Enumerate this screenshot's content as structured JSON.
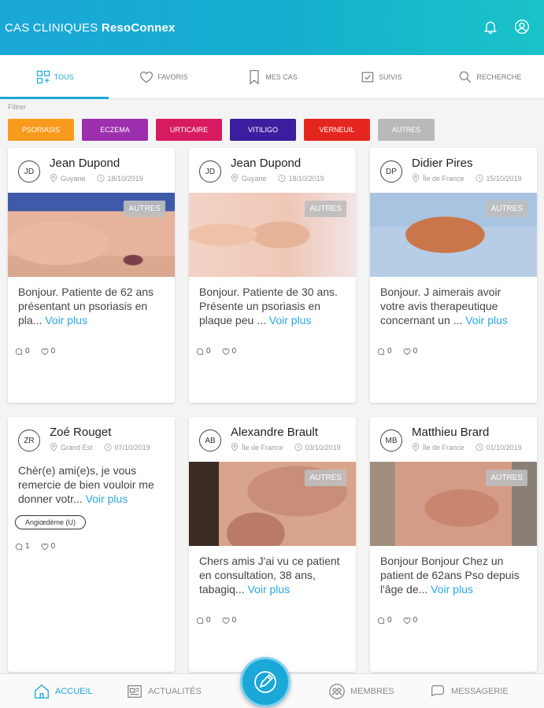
{
  "header": {
    "title_prefix": "CAS CLINIQUES",
    "title_brand": "ResoConnex"
  },
  "tabs": [
    {
      "label": "TOUS",
      "icon": "grid-icon",
      "active": true
    },
    {
      "label": "FAVORIS",
      "icon": "heart-icon"
    },
    {
      "label": "MES CAS",
      "icon": "bookmark-icon"
    },
    {
      "label": "SUIVIS",
      "icon": "follow-icon"
    },
    {
      "label": "RECHERCHE",
      "icon": "search-icon"
    }
  ],
  "filter_label": "Filtrer",
  "filters": [
    "PSORIASIS",
    "ECZEMA",
    "URTICAIRE",
    "VITILIGO",
    "VERNEUIL",
    "AUTRES"
  ],
  "colors": {
    "primary": "#1ba7d8",
    "link": "#2ba7e0"
  },
  "cards": [
    {
      "initials": "JD",
      "name": "Jean Dupond",
      "location": "Guyane",
      "date": "18/10/2019",
      "badge": "AUTRES",
      "text": "Bonjour. Patiente de 62 ans présentant un psoriasis en pla...",
      "more": "Voir plus",
      "comments": "0",
      "likes": "0"
    },
    {
      "initials": "JD",
      "name": "Jean Dupond",
      "location": "Guyane",
      "date": "18/10/2019",
      "badge": "AUTRES",
      "text": "Bonjour. Patiente de 30 ans. Présente un psoriasis en plaque peu ...",
      "more": "Voir plus",
      "comments": "0",
      "likes": "0"
    },
    {
      "initials": "DP",
      "name": "Didier Pires",
      "location": "Île de France",
      "date": "15/10/2019",
      "badge": "AUTRES",
      "text": "Bonjour. J aimerais avoir votre avis therapeutique concernant un ...",
      "more": "Voir plus",
      "comments": "0",
      "likes": "0"
    },
    {
      "initials": "ZR",
      "name": "Zoé Rouget",
      "location": "Grand Est",
      "date": "07/10/2019",
      "text": "Chèr(e) ami(e)s, je vous remercie de bien vouloir me donner votr...",
      "more": "Voir plus",
      "tag": "Angiœdème (U)",
      "comments": "1",
      "likes": "0"
    },
    {
      "initials": "AB",
      "name": "Alexandre Brault",
      "location": "Île de France",
      "date": "03/10/2019",
      "badge": "AUTRES",
      "text": "Chers amis J'ai vu ce patient en consultation, 38 ans, tabagiq...",
      "more": "Voir plus",
      "comments": "0",
      "likes": "0"
    },
    {
      "initials": "MB",
      "name": "Matthieu Brard",
      "location": "Île de France",
      "date": "01/10/2019",
      "badge": "AUTRES",
      "text": "Bonjour Bonjour Chez un patient de 62ans Pso depuis l'âge de...",
      "more": "Voir plus",
      "comments": "0",
      "likes": "0"
    }
  ],
  "bottom_nav": [
    {
      "label": "ACCUEIL",
      "icon": "home-icon",
      "active": true
    },
    {
      "label": "ACTUALITÉS",
      "icon": "news-icon"
    },
    {
      "label": "MEMBRES",
      "icon": "members-icon"
    },
    {
      "label": "MESSAGERIE",
      "icon": "chat-icon"
    }
  ],
  "fab": {
    "icon": "pen-icon"
  }
}
